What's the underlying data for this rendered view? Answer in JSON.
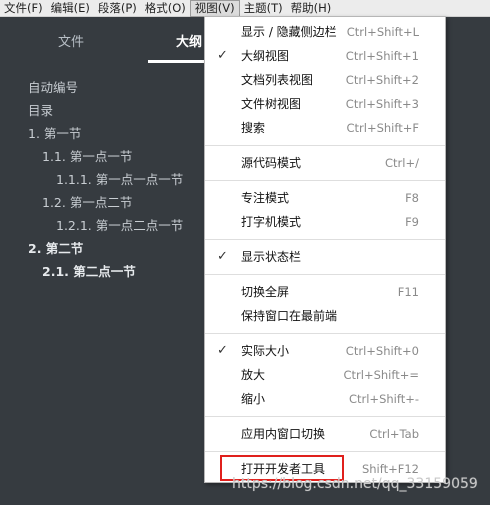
{
  "menubar": {
    "items": [
      "文件(F)",
      "编辑(E)",
      "段落(P)",
      "格式(O)",
      "视图(V)",
      "主题(T)",
      "帮助(H)"
    ]
  },
  "sidebar": {
    "tabs": {
      "files": "文件",
      "outline": "大纲"
    },
    "outline": [
      "自动编号",
      "目录",
      "1. 第一节",
      "1.1. 第一点一节",
      "1.1.1. 第一点一点一节",
      "1.2. 第一点二节",
      "1.2.1. 第一点二点一节",
      "2. 第二节",
      "2.1. 第二点一节"
    ]
  },
  "view_menu": {
    "items": [
      {
        "label": "显示 / 隐藏侧边栏",
        "shortcut": "Ctrl+Shift+L",
        "checked": false
      },
      {
        "label": "大纲视图",
        "shortcut": "Ctrl+Shift+1",
        "checked": true
      },
      {
        "label": "文档列表视图",
        "shortcut": "Ctrl+Shift+2",
        "checked": false
      },
      {
        "label": "文件树视图",
        "shortcut": "Ctrl+Shift+3",
        "checked": false
      },
      {
        "label": "搜索",
        "shortcut": "Ctrl+Shift+F",
        "checked": false
      },
      {
        "label": "源代码模式",
        "shortcut": "Ctrl+/",
        "checked": false
      },
      {
        "label": "专注模式",
        "shortcut": "F8",
        "checked": false
      },
      {
        "label": "打字机模式",
        "shortcut": "F9",
        "checked": false
      },
      {
        "label": "显示状态栏",
        "shortcut": "",
        "checked": true
      },
      {
        "label": "切换全屏",
        "shortcut": "F11",
        "checked": false
      },
      {
        "label": "保持窗口在最前端",
        "shortcut": "",
        "checked": false
      },
      {
        "label": "实际大小",
        "shortcut": "Ctrl+Shift+0",
        "checked": true
      },
      {
        "label": "放大",
        "shortcut": "Ctrl+Shift+=",
        "checked": false
      },
      {
        "label": "缩小",
        "shortcut": "Ctrl+Shift+-",
        "checked": false
      },
      {
        "label": "应用内窗口切换",
        "shortcut": "Ctrl+Tab",
        "checked": false
      },
      {
        "label": "打开开发者工具",
        "shortcut": "Shift+F12",
        "checked": false
      }
    ],
    "check_glyph": "✓"
  },
  "watermark": "https://blog.csdn.net/qq_33159059",
  "colors": {
    "highlight_box": "#e0201c",
    "sidebar_bg": "#363b40"
  }
}
